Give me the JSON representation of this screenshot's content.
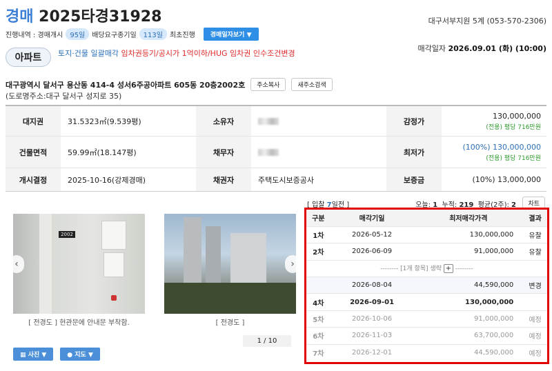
{
  "header": {
    "type_label": "경매",
    "case_no": "2025타경31928",
    "court": "대구서부지원 5계 (053-570-2306)",
    "progress_prefix": "진행내역 : 경매개시",
    "days1": "95일",
    "mid": "배당요구종기일",
    "days2": "113일",
    "stage": "최초진행",
    "detail_btn": "경매일자보기 ▼"
  },
  "badge": "아파트",
  "notice_blue": "토지·건물 일괄매각",
  "notice_red": "임차권등기/공시가 1억이하/HUG 임차권 인수조건변경",
  "sale_date_label": "매각일자",
  "sale_date": "2026.09.01 (화) (10:00)",
  "address": "대구광역시 달서구 용산동 414-4 성서6주공아파트 605동 20층2002호",
  "copy_btn": "주소복사",
  "newaddr_btn": "새주소검색",
  "road_address": "(도로명주소:대구 달서구 성지로 35)",
  "info": {
    "r1": {
      "l1": "대지권",
      "v1": "31.5323㎡(9.539평)",
      "l2": "소유자",
      "l3": "감정가",
      "v3": "130,000,000",
      "s3": "(전용) 평당 716만원"
    },
    "r2": {
      "l1": "건물면적",
      "v1": "59.99㎡(18.147평)",
      "l2": "채무자",
      "l3": "최저가",
      "v3": "(100%) 130,000,000",
      "s3": "(전용) 평당 716만원"
    },
    "r3": {
      "l1": "개시결정",
      "v1": "2025-10-16(강제경매)",
      "l2": "채권자",
      "v2": "주택도시보증공사",
      "l3": "보증금",
      "v3": "(10%) 13,000,000"
    }
  },
  "bid_header": {
    "pre": "[ 입찰 ",
    "n": "7",
    "post": "일전 ]"
  },
  "stats": {
    "today_l": "오늘:",
    "today": "1",
    "total_l": "누적:",
    "total": "219",
    "avg_l": "평균(2주):",
    "avg": "2",
    "chart_btn": "차트"
  },
  "history": {
    "headers": [
      "구분",
      "매각기일",
      "최저매각가격",
      "결과"
    ],
    "r1": [
      "1차",
      "2026-05-12",
      "130,000,000",
      "유찰"
    ],
    "r2": [
      "2차",
      "2026-06-09",
      "91,000,000",
      "유찰"
    ],
    "omit": "-------- [1개 항목] 생략",
    "omit_tail": "--------",
    "r3": [
      "",
      "2026-08-04",
      "44,590,000",
      "변경"
    ],
    "r4": [
      "4차",
      "2026-09-01",
      "130,000,000",
      ""
    ],
    "r5": [
      "5차",
      "2026-10-06",
      "91,000,000",
      "예정"
    ],
    "r6": [
      "6차",
      "2026-11-03",
      "63,700,000",
      "예정"
    ],
    "r7": [
      "7차",
      "2026-12-01",
      "44,590,000",
      "예정"
    ]
  },
  "photos": {
    "door_no": "2002",
    "cap1_a": "[ 전경도 ]",
    "cap1_b": "현관문에 안내문 부착함.",
    "cap2": "[ 전경도 ]",
    "pager": "1 / 10",
    "photo_btn": "사진 ▼",
    "map_btn": "지도 ▼"
  }
}
